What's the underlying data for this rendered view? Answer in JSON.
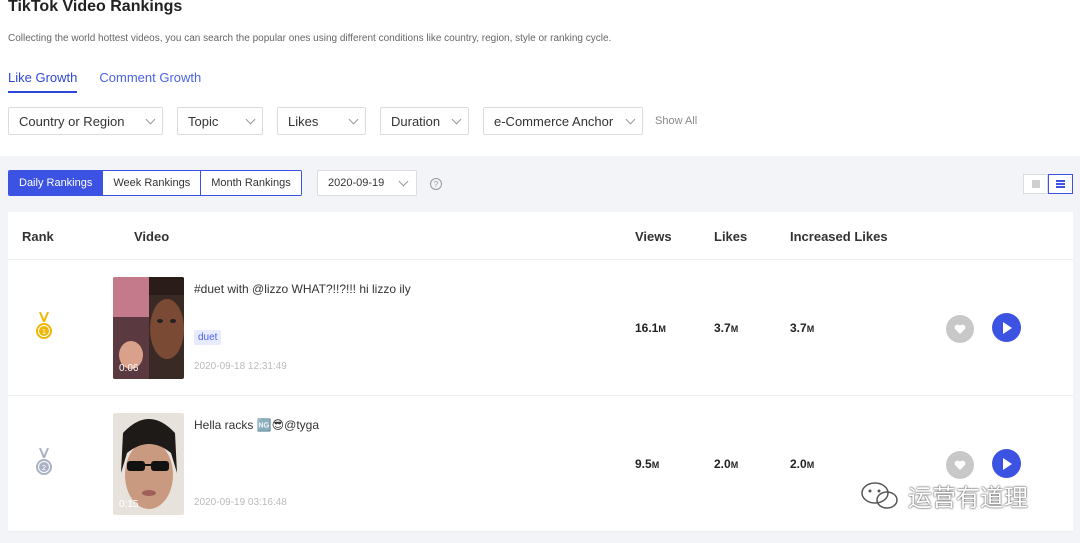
{
  "header": {
    "title": "TikTok Video Rankings",
    "subtitle": "Collecting the world hottest videos, you can search the popular ones using different conditions like country, region, style or ranking cycle."
  },
  "tabs": [
    {
      "label": "Like Growth",
      "active": true
    },
    {
      "label": "Comment Growth",
      "active": false
    }
  ],
  "filters": [
    {
      "label": "Country or Region"
    },
    {
      "label": "Topic"
    },
    {
      "label": "Likes"
    },
    {
      "label": "Duration"
    },
    {
      "label": "e-Commerce Anchor"
    }
  ],
  "show_all_label": "Show All",
  "ranking_tabs": [
    {
      "label": "Daily Rankings",
      "active": true
    },
    {
      "label": "Week Rankings",
      "active": false
    },
    {
      "label": "Month Rankings",
      "active": false
    }
  ],
  "date_select": {
    "value": "2020-09-19"
  },
  "help_icon": "?",
  "table": {
    "headers": {
      "rank": "Rank",
      "video": "Video",
      "views": "Views",
      "likes": "Likes",
      "increased_likes": "Increased Likes"
    },
    "rows": [
      {
        "rank_icon": "gold-medal-icon",
        "title": "#duet with @lizzo WHAT?!!?!!! hi lizzo ily",
        "tag": "duet",
        "duration": "0:06",
        "date": "2020-09-18 12:31:49",
        "views": "16.1",
        "likes": "3.7",
        "increased_likes": "3.7",
        "unit": "M"
      },
      {
        "rank_icon": "silver-medal-icon",
        "title": "Hella racks 🆖😎@tyga",
        "tag": "",
        "duration": "0:15",
        "date": "2020-09-19 03:16:48",
        "views": "9.5",
        "likes": "2.0",
        "increased_likes": "2.0",
        "unit": "M"
      }
    ]
  },
  "watermark": "运营有道理",
  "colors": {
    "accent": "#3b52e3",
    "gold": "#f2b705",
    "silver": "#aab2c4"
  }
}
